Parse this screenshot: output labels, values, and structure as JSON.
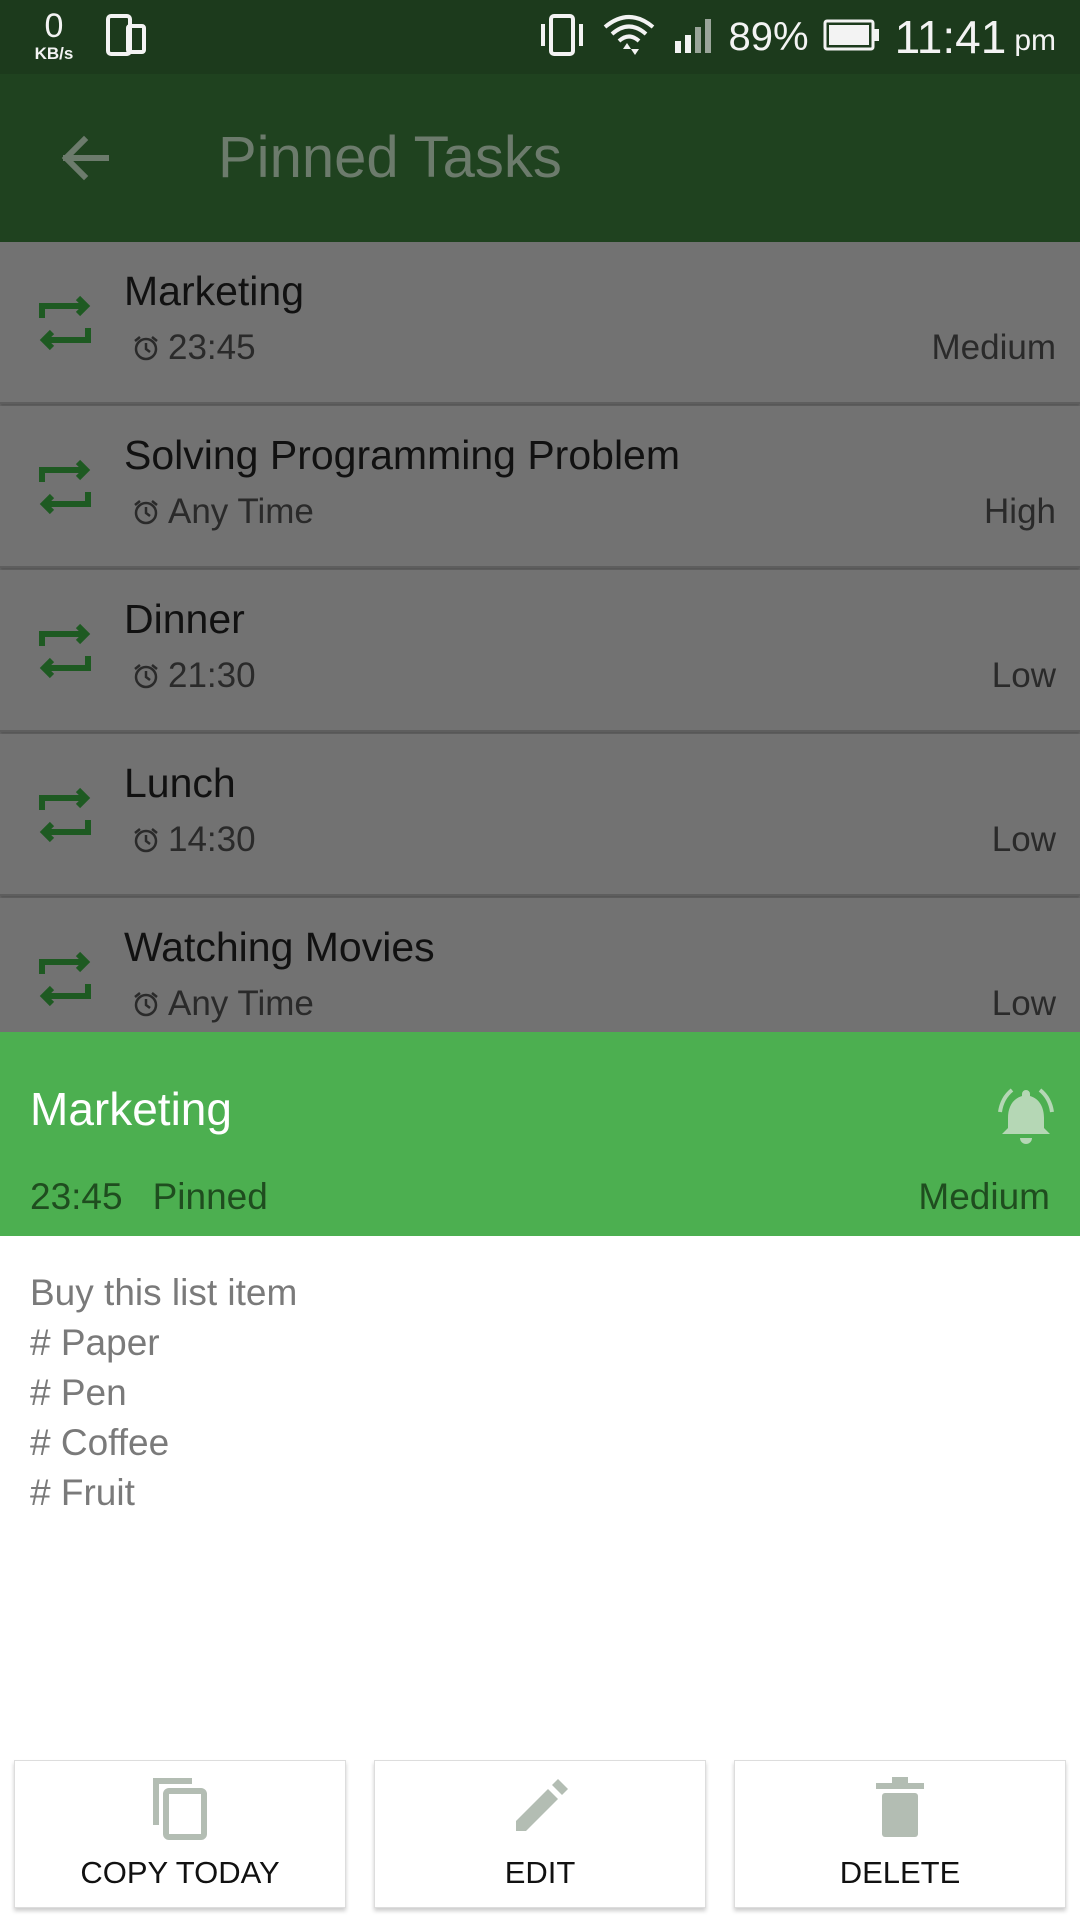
{
  "status_bar": {
    "net_speed": "0",
    "net_unit": "KB/s",
    "battery_pct": "89%",
    "time": "11:41",
    "ampm": "pm"
  },
  "app_bar": {
    "title": "Pinned Tasks",
    "back_icon": "arrow-back-icon"
  },
  "tasks": [
    {
      "title": "Marketing",
      "time": "23:45",
      "priority": "Medium"
    },
    {
      "title": "Solving Programming Problem",
      "time": "Any Time",
      "priority": "High"
    },
    {
      "title": "Dinner",
      "time": "21:30",
      "priority": "Low"
    },
    {
      "title": "Lunch",
      "time": "14:30",
      "priority": "Low"
    },
    {
      "title": "Watching Movies",
      "time": "Any Time",
      "priority": "Low"
    }
  ],
  "sheet": {
    "title": "Marketing",
    "time": "23:45",
    "status": "Pinned",
    "priority": "Medium",
    "note_lines": [
      "Buy this list item",
      "# Paper",
      "# Pen",
      "# Coffee",
      "# Fruit"
    ]
  },
  "actions": {
    "copy_label": "COPY TODAY",
    "edit_label": "EDIT",
    "delete_label": "DELETE"
  },
  "colors": {
    "status_bar": "#1c3a1c",
    "app_bar": "#1f421f",
    "accent": "#4caf50",
    "icon_green": "#1e5a22",
    "action_icon": "#b3bdb3"
  }
}
